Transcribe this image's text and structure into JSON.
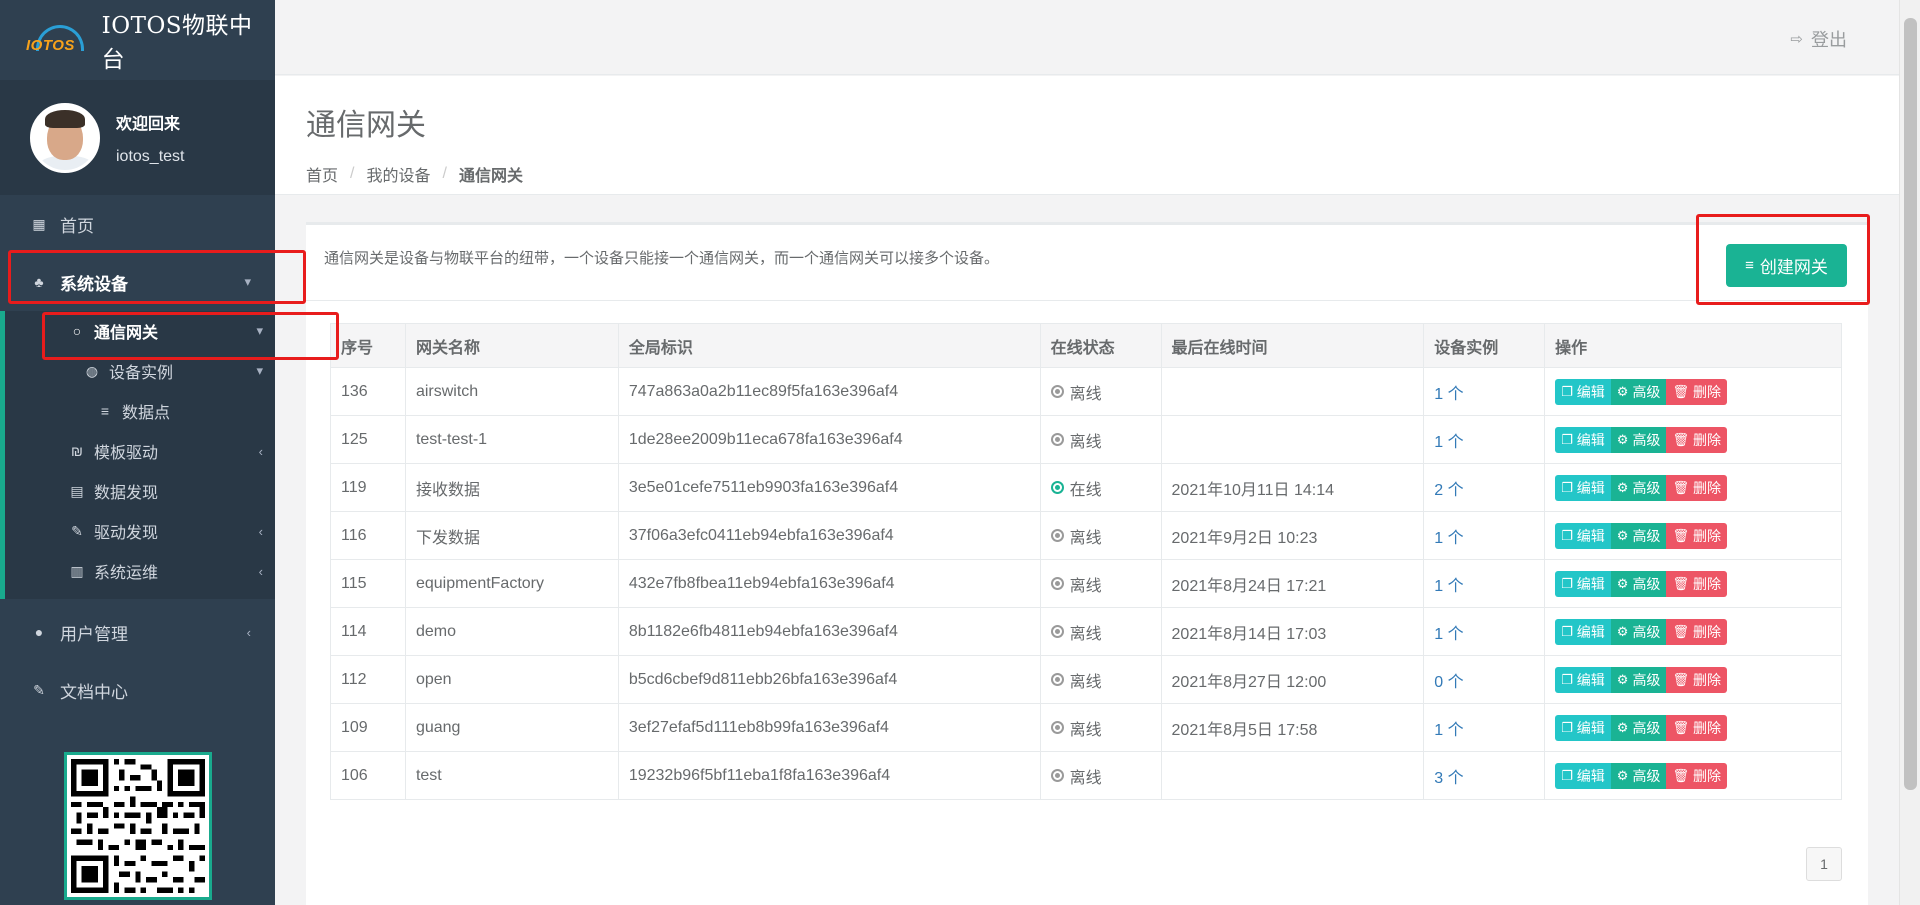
{
  "brand": {
    "logo_text": "IOTOS",
    "title": "IOTOS物联中台"
  },
  "profile": {
    "welcome": "欢迎回来",
    "username": "iotos_test"
  },
  "nav": {
    "home": "首页",
    "system_devices": "系统设备",
    "sub": {
      "gateway": "通信网关",
      "device_instance": "设备实例",
      "data_point": "数据点",
      "template_driver": "模板驱动",
      "data_discovery": "数据发现",
      "driver_discovery": "驱动发现",
      "system_ops": "系统运维"
    },
    "user_mgmt": "用户管理",
    "docs": "文档中心"
  },
  "topbar": {
    "logout": "登出"
  },
  "page": {
    "title": "通信网关",
    "breadcrumb": [
      "首页",
      "我的设备",
      "通信网关"
    ]
  },
  "box": {
    "description": "通信网关是设备与物联平台的纽带，一个设备只能接一个通信网关，而一个通信网关可以接多个设备。",
    "create_button": "创建网关"
  },
  "table": {
    "headers": [
      "序号",
      "网关名称",
      "全局标识",
      "在线状态",
      "最后在线时间",
      "设备实例",
      "操作"
    ],
    "rows": [
      {
        "id": "136",
        "name": "airswitch",
        "uid": "747a863a0a2b11ec89f5fa163e396af4",
        "status": "离线",
        "online": false,
        "last": "",
        "instances": "1 个"
      },
      {
        "id": "125",
        "name": "test-test-1",
        "uid": "1de28ee2009b11eca678fa163e396af4",
        "status": "离线",
        "online": false,
        "last": "",
        "instances": "1 个"
      },
      {
        "id": "119",
        "name": "接收数据",
        "uid": "3e5e01cefe7511eb9903fa163e396af4",
        "status": "在线",
        "online": true,
        "last": "2021年10月11日 14:14",
        "instances": "2 个"
      },
      {
        "id": "116",
        "name": "下发数据",
        "uid": "37f06a3efc0411eb94ebfa163e396af4",
        "status": "离线",
        "online": false,
        "last": "2021年9月2日 10:23",
        "instances": "1 个"
      },
      {
        "id": "115",
        "name": "equipmentFactory",
        "uid": "432e7fb8fbea11eb94ebfa163e396af4",
        "status": "离线",
        "online": false,
        "last": "2021年8月24日 17:21",
        "instances": "1 个"
      },
      {
        "id": "114",
        "name": "demo",
        "uid": "8b1182e6fb4811eb94ebfa163e396af4",
        "status": "离线",
        "online": false,
        "last": "2021年8月14日 17:03",
        "instances": "1 个"
      },
      {
        "id": "112",
        "name": "open",
        "uid": "b5cd6cbef9d811ebb26bfa163e396af4",
        "status": "离线",
        "online": false,
        "last": "2021年8月27日 12:00",
        "instances": "0 个"
      },
      {
        "id": "109",
        "name": "guang",
        "uid": "3ef27efaf5d111eb8b99fa163e396af4",
        "status": "离线",
        "online": false,
        "last": "2021年8月5日 17:58",
        "instances": "1 个"
      },
      {
        "id": "106",
        "name": "test",
        "uid": "19232b96f5bf11eba1f8fa163e396af4",
        "status": "离线",
        "online": false,
        "last": "",
        "instances": "3 个"
      }
    ],
    "actions": {
      "edit": "编辑",
      "advanced": "高级",
      "delete": "删除"
    }
  },
  "pagination": {
    "current": "1"
  },
  "colors": {
    "sidebar": "#2f4050",
    "accent": "#1ab394",
    "info": "#23c6c8",
    "danger": "#ed5565",
    "highlight": "#e81c1c"
  }
}
